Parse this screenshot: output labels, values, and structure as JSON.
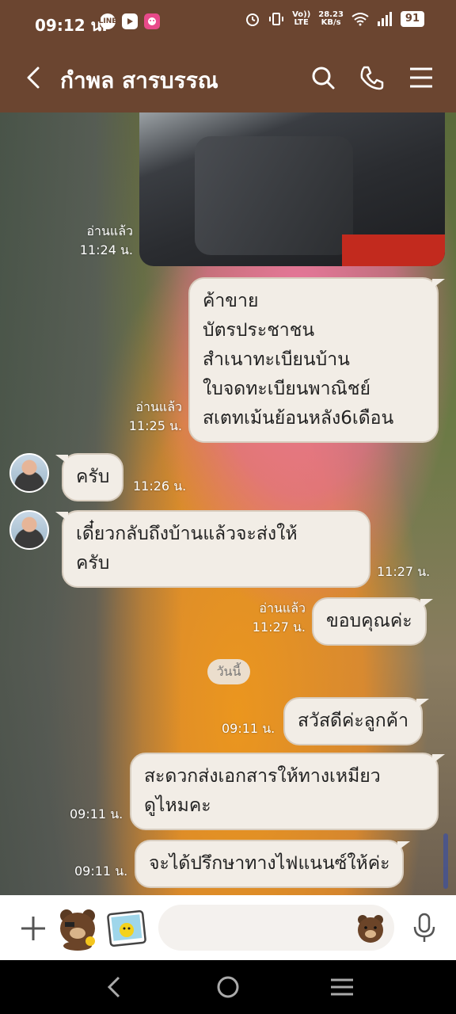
{
  "status_bar": {
    "time": "09:12 น.",
    "apps": [
      "LINE",
      "YouTube",
      "App"
    ],
    "network_speed_top": "28.23",
    "network_speed_bottom": "KB/s",
    "volte_top": "Vo))",
    "volte_bottom": "LTE",
    "battery": "91"
  },
  "header": {
    "title": "กำพล สารบรรณ",
    "icons": [
      "back-icon",
      "search-icon",
      "phone-icon",
      "menu-icon"
    ]
  },
  "chat": {
    "read_label": "อ่านแล้ว",
    "photo_time": "11:24 น.",
    "msg1_lines": [
      "ค้าขาย",
      "บัตรประชาชน",
      "สำเนาทะเบียนบ้าน",
      "ใบจดทะเบียนพาณิชย์",
      "สเตทเม้นย้อนหลัง6เดือน"
    ],
    "msg1_time": "11:25 น.",
    "msg2_text": "ครับ",
    "msg2_time": "11:26 น.",
    "msg3_lines": [
      "เดี๋ยวกลับถึงบ้านแล้วจะส่งให้",
      "ครับ"
    ],
    "msg3_time": "11:27 น.",
    "msg4_text": "ขอบคุณค่ะ",
    "msg4_time": "11:27 น.",
    "date_separator": "วันนี้",
    "msg5_text": "สวัสดีค่ะลูกค้า",
    "msg5_time": "09:11 น.",
    "msg6_lines": [
      "สะดวกส่งเอกสารให้ทางเหมียว",
      "ดูไหมคะ"
    ],
    "msg6_time": "09:11 น.",
    "msg7_text": "จะได้ปรึกษาทางไฟแนนซ์ให้ค่ะ",
    "msg7_time": "09:11 น."
  },
  "input": {
    "placeholder": ""
  },
  "colors": {
    "header": "#6b4530",
    "bubble": "#f2ede6",
    "input_bg": "#f4f1ee"
  }
}
